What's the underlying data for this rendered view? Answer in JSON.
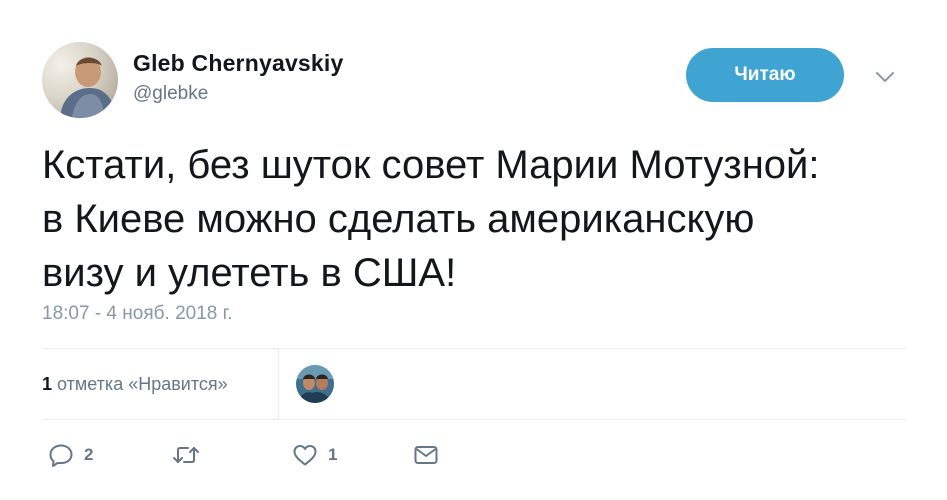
{
  "author": {
    "display_name": "Gleb Chernyavskiy",
    "handle": "@glebke"
  },
  "follow_button": {
    "label": "Читаю"
  },
  "tweet": {
    "text_lines": [
      "Кстати, без шуток совет Марии Мотузной:",
      "в Киеве можно сделать американскую",
      "визу и улететь в США!"
    ],
    "timestamp": "18:07 - 4 нояб. 2018 г."
  },
  "stats": {
    "likes_count": "1",
    "likes_label": "отметка «Нравится»"
  },
  "actions": {
    "reply_count": "2",
    "retweet_count": "",
    "like_count": "1"
  },
  "icons": {
    "reply": "reply-icon",
    "retweet": "retweet-icon",
    "like": "heart-icon",
    "message": "envelope-icon",
    "caret": "chevron-down-icon"
  },
  "colors": {
    "accent": "#40a4d2",
    "text": "#14171a",
    "secondary_text": "#657786",
    "muted_text": "#8899a6",
    "divider": "#e6ecf0"
  }
}
